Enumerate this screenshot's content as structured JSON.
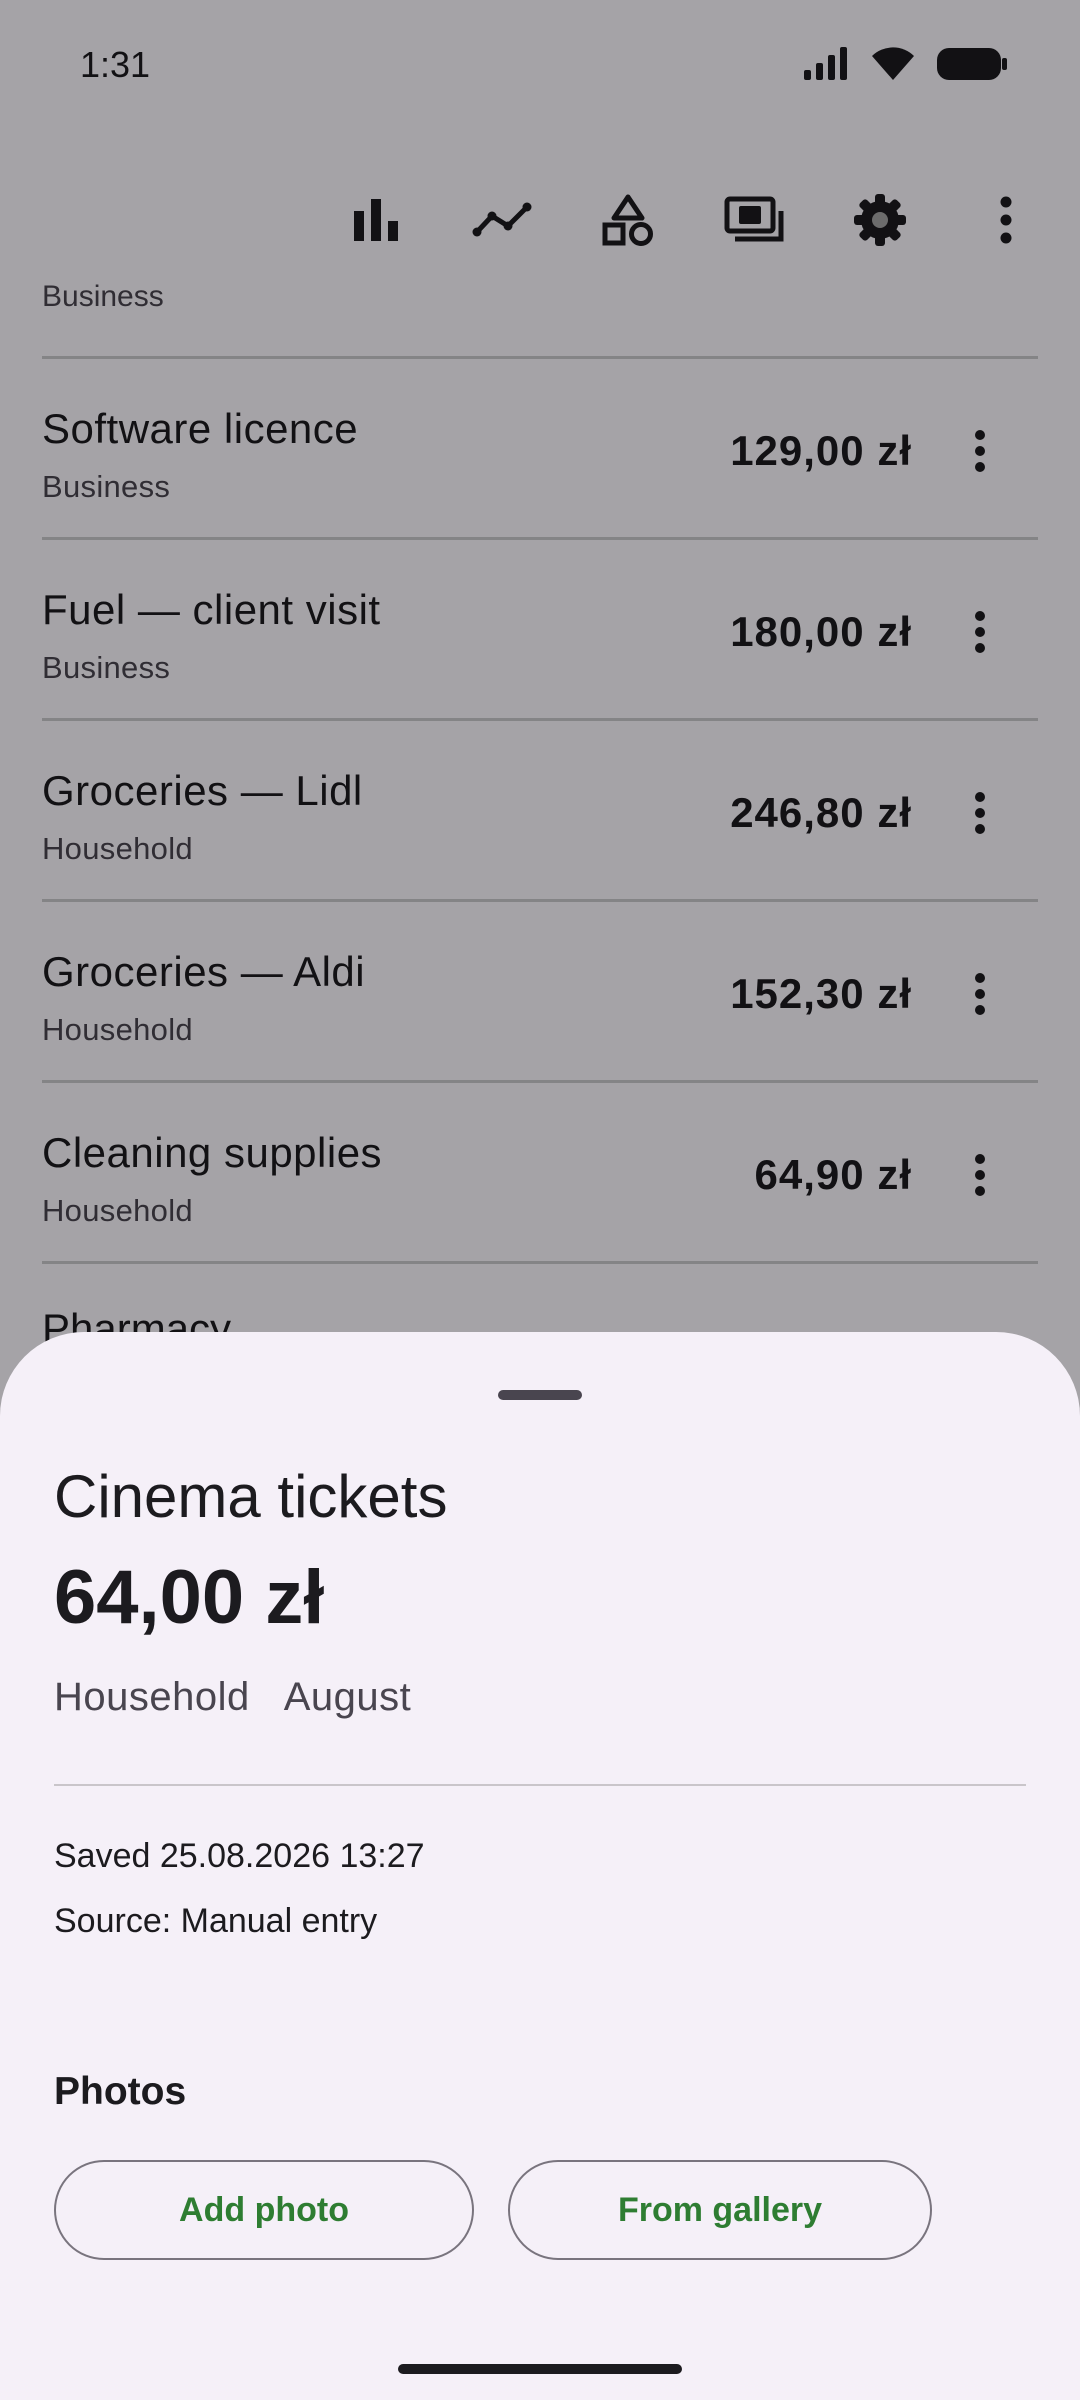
{
  "status_bar": {
    "time": "1:31"
  },
  "toolbar": {
    "icons": [
      "bar-chart-icon",
      "line-chart-icon",
      "shapes-icon",
      "payments-icon",
      "gear-icon",
      "more-vert-icon"
    ]
  },
  "list": {
    "partial_top_subtitle": "Business",
    "items": [
      {
        "title": "Software licence",
        "category": "Business",
        "amount": "129,00 zł"
      },
      {
        "title": "Fuel — client visit",
        "category": "Business",
        "amount": "180,00 zł"
      },
      {
        "title": "Groceries — Lidl",
        "category": "Household",
        "amount": "246,80 zł"
      },
      {
        "title": "Groceries — Aldi",
        "category": "Household",
        "amount": "152,30 zł"
      },
      {
        "title": "Cleaning supplies",
        "category": "Household",
        "amount": "64,90 zł"
      }
    ],
    "partial_bottom_title": "Pharmacy"
  },
  "sheet": {
    "title": "Cinema tickets",
    "amount": "64,00 zł",
    "category": "Household",
    "month": "August",
    "saved": "Saved 25.08.2026 13:27",
    "source": "Source: Manual entry",
    "photos_heading": "Photos",
    "add_photo_label": "Add photo",
    "from_gallery_label": "From gallery",
    "accent_color": "#2e7d32"
  }
}
